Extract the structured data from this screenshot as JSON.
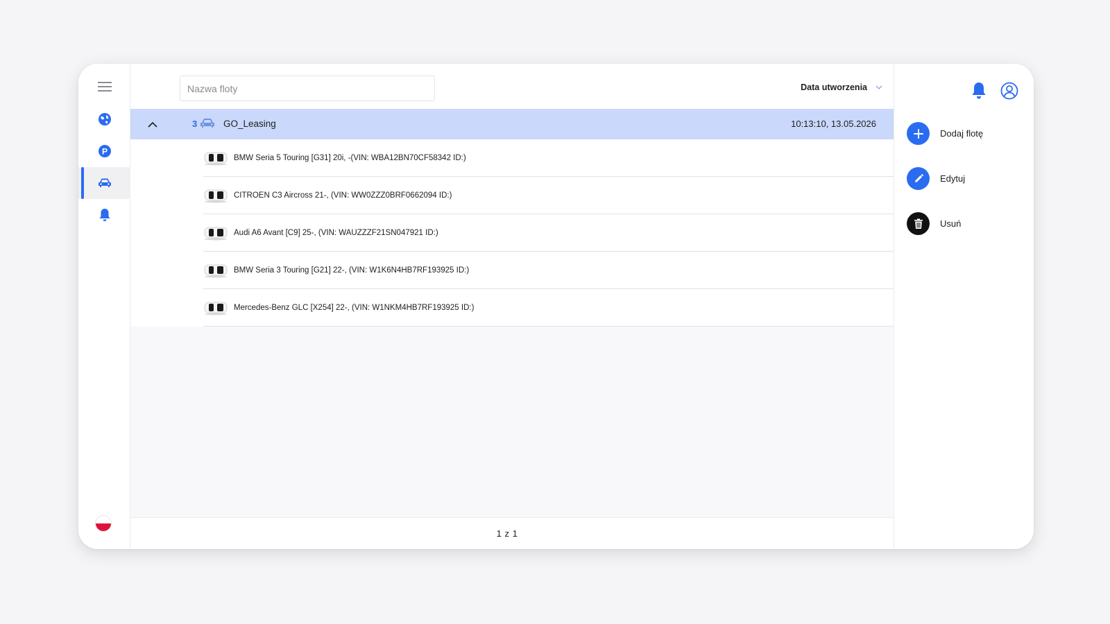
{
  "nav": {
    "items": [
      {
        "name": "menu",
        "icon": "hamburger-menu-icon"
      },
      {
        "name": "map",
        "icon": "globe-icon"
      },
      {
        "name": "parking",
        "icon": "parking-icon",
        "glyph": "P"
      },
      {
        "name": "fleet",
        "icon": "car-icon",
        "active": true
      },
      {
        "name": "notifications",
        "icon": "bell-icon"
      }
    ],
    "language_flag": "flag-poland-icon"
  },
  "toolbar": {
    "search_placeholder": "Nazwa floty",
    "sort_label": "Data utworzenia"
  },
  "fleet": {
    "count": "3",
    "name": "GO_Leasing",
    "created": "10:13:10, 13.05.2026",
    "vehicles": [
      {
        "label": "BMW Seria 5 Touring [G31] 20i, -(VIN: WBA12BN70CF58342 ID:)"
      },
      {
        "label": "CITROEN C3 Aircross 21-, (VIN: WW0ZZZ0BRF0662094 ID:)"
      },
      {
        "label": "Audi A6 Avant [C9] 25-, (VIN: WAUZZZF21SN047921 ID:)"
      },
      {
        "label": "BMW Seria 3 Touring [G21] 22-, (VIN: W1K6N4HB7RF193925 ID:)"
      },
      {
        "label": "Mercedes-Benz GLC [X254] 22-, (VIN: W1NKM4HB7RF193925 ID:)"
      }
    ]
  },
  "pagination": {
    "text": "1 z 1"
  },
  "actions": {
    "add_label": "Dodaj flotę",
    "edit_label": "Edytuj",
    "delete_label": "Usuń"
  },
  "colors": {
    "accent": "#2a6cf0",
    "selected_row": "#c9d8fb",
    "delete": "#111111"
  }
}
